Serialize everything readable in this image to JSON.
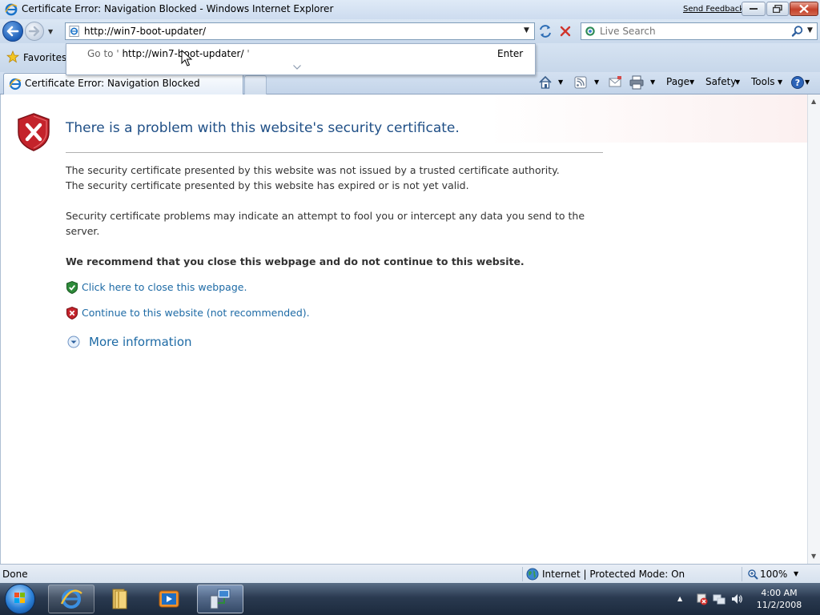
{
  "window": {
    "title": "Certificate Error: Navigation Blocked - Windows Internet Explorer",
    "send_feedback": "Send Feedback"
  },
  "nav": {
    "address": "http://win7-boot-updater/",
    "search_placeholder": "Live Search"
  },
  "autocomplete": {
    "go_to_prefix": "Go to '",
    "url": "http://win7-boot-updater/",
    "go_to_suffix": "'",
    "enter_label": "Enter"
  },
  "favorites": {
    "label": "Favorites"
  },
  "tabs": [
    {
      "title": "Certificate Error: Navigation Blocked"
    }
  ],
  "command_bar": {
    "page": "Page",
    "safety": "Safety",
    "tools": "Tools"
  },
  "content": {
    "heading": "There is a problem with this website's security certificate.",
    "line1": "The security certificate presented by this website was not issued by a trusted certificate authority.",
    "line2": "The security certificate presented by this website has expired or is not yet valid.",
    "para2": "Security certificate problems may indicate an attempt to fool you or intercept any data you send to the server.",
    "recommendation": "We recommend that you close this webpage and do not continue to this website.",
    "close_link": "Click here to close this webpage.",
    "continue_link": "Continue to this website (not recommended).",
    "more_info": "More information"
  },
  "status": {
    "text": "Done",
    "zone": "Internet | Protected Mode: On",
    "zoom": "100%"
  },
  "taskbar": {
    "time": "4:00 AM",
    "date": "11/2/2008"
  },
  "colors": {
    "link": "#1d6aa5",
    "heading": "#1f4f86",
    "error_shield": "#c4232b",
    "safe_shield": "#2e8b3a"
  },
  "icons": [
    "ie-icon",
    "back-arrow-icon",
    "forward-arrow-icon",
    "refresh-icon",
    "stop-icon",
    "live-search-icon",
    "magnifier-icon",
    "favorites-star-icon",
    "home-icon",
    "feeds-icon",
    "mail-icon",
    "print-icon",
    "help-icon",
    "error-shield-icon",
    "green-shield-icon",
    "red-shield-icon",
    "chevron-down-circle-icon",
    "globe-icon",
    "zoom-icon",
    "windows-orb-icon",
    "folder-icon",
    "media-player-icon",
    "network-icon",
    "volume-icon"
  ]
}
